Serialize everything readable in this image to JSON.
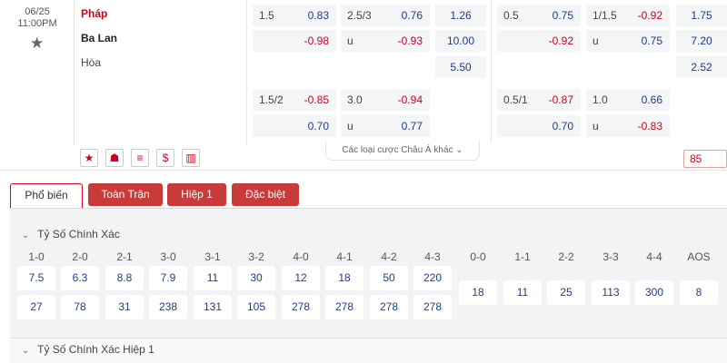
{
  "match": {
    "date": "06/25",
    "time": "11:00PM",
    "home": "Pháp",
    "away": "Ba Lan",
    "draw": "Hòa"
  },
  "odds": {
    "r1": {
      "h1": "1.5",
      "h1v": "0.83",
      "ou1": "2.5/3",
      "ou1v": "0.76",
      "x1": "1.26",
      "h2": "0.5",
      "h2v": "0.75",
      "ou2": "1/1.5",
      "ou2v": "-0.92",
      "x2": "1.75"
    },
    "r2": {
      "h1v": "-0.98",
      "u1": "u",
      "ou1v": "-0.93",
      "x1": "10.00",
      "h2v": "-0.92",
      "u2": "u",
      "ou2v": "0.75",
      "x2": "7.20"
    },
    "r3": {
      "x1": "5.50",
      "x2": "2.52"
    },
    "r4": {
      "h1": "1.5/2",
      "h1v": "-0.85",
      "ou1": "3.0",
      "ou1v": "-0.94",
      "h2": "0.5/1",
      "h2v": "-0.87",
      "ou2": "1.0",
      "ou2v": "0.66"
    },
    "r5": {
      "h1v": "0.70",
      "u1": "u",
      "ou1v": "0.77",
      "h2v": "0.70",
      "u2": "u",
      "ou2v": "-0.83"
    }
  },
  "tools": {
    "star": "★",
    "bell": "☗",
    "list": "≡",
    "dollar": "$",
    "chart": "▥"
  },
  "more_bets": "Các loại cược Châu Á khác",
  "more_count": "85",
  "tabs": [
    "Phổ biến",
    "Toàn Trận",
    "Hiệp 1",
    "Đặc biệt"
  ],
  "section1": {
    "title": "Tỷ Số Chính Xác",
    "headers": [
      "1-0",
      "2-0",
      "2-1",
      "3-0",
      "3-1",
      "3-2",
      "4-0",
      "4-1",
      "4-2",
      "4-3",
      "0-0",
      "1-1",
      "2-2",
      "3-3",
      "4-4",
      "AOS"
    ],
    "row1": [
      "7.5",
      "6.3",
      "8.8",
      "7.9",
      "11",
      "30",
      "12",
      "18",
      "50",
      "220"
    ],
    "row2": [
      "27",
      "78",
      "31",
      "238",
      "131",
      "105",
      "278",
      "278",
      "278",
      "278"
    ],
    "draws": [
      "18",
      "11",
      "25",
      "113",
      "300",
      "8"
    ]
  },
  "section2": {
    "title": "Tỷ Số Chính Xác Hiệp 1"
  },
  "colors": {
    "accent": "#d0021b",
    "odds_blue": "#1f3c88",
    "tab_red": "#c93a3a"
  },
  "icons": [
    "star-icon",
    "chevron-down-icon",
    "bell-icon",
    "list-icon",
    "dollar-icon",
    "chart-icon"
  ]
}
